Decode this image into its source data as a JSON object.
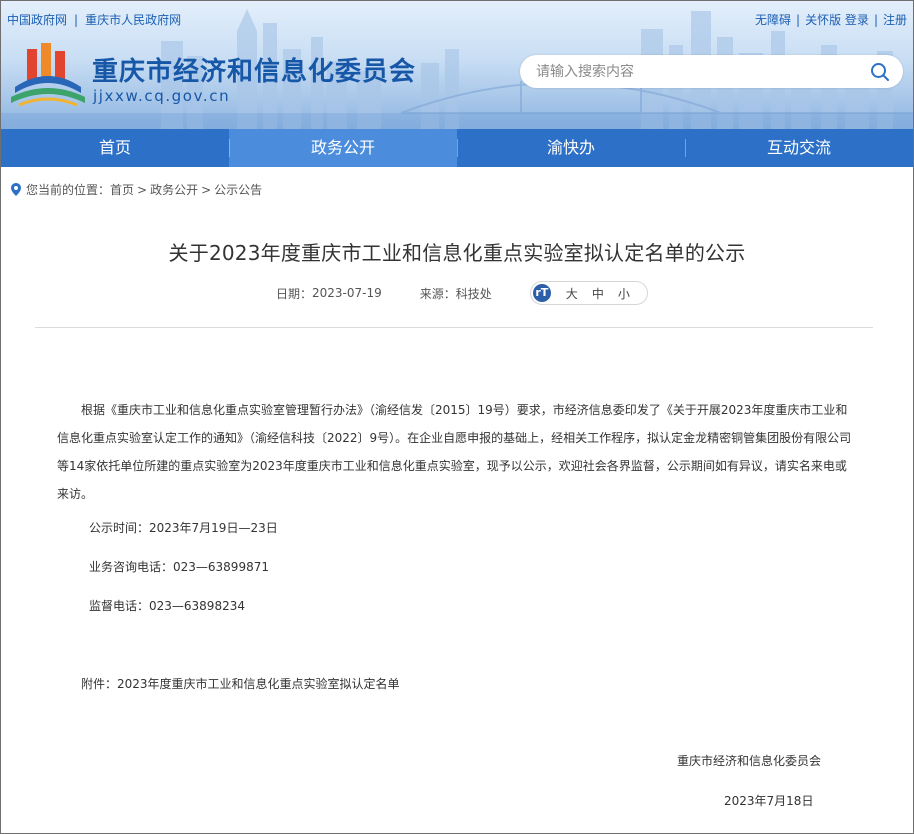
{
  "header": {
    "top_links": [
      "中国政府网",
      "重庆市人民政府网"
    ],
    "right_links": [
      "无障碍",
      "关怀版",
      "登录",
      "注册"
    ],
    "site_title": "重庆市经济和信息化委员会",
    "site_domain": "jjxxw.cq.gov.cn",
    "search_placeholder": "请输入搜索内容",
    "search_icon": "search-icon",
    "logo_icon": "emblem-logo-icon"
  },
  "nav": {
    "items": [
      "首页",
      "政务公开",
      "渝快办",
      "互动交流"
    ],
    "active_index": 1
  },
  "breadcrumb": {
    "prefix": "您当前的位置：",
    "items": [
      "首页",
      "政务公开",
      "公示公告"
    ],
    "separator": ">",
    "icon": "location-pin-icon"
  },
  "article": {
    "title": "关于2023年度重庆市工业和信息化重点实验室拟认定名单的公示",
    "date_label": "日期：",
    "date": "2023-07-19",
    "source_label": "来源：",
    "source": "科技处",
    "font_size_icon": "font-size-icon",
    "font_sizes": [
      "大",
      "中",
      "小"
    ],
    "paragraph": "根据《重庆市工业和信息化重点实验室管理暂行办法》（渝经信发〔2015〕19号）要求，市经济信息委印发了《关于开展2023年度重庆市工业和信息化重点实验室认定工作的通知》（渝经信科技〔2022〕9号）。在企业自愿申报的基础上，经相关工作程序，拟认定金龙精密铜管集团股份有限公司等14家依托单位所建的重点实验室为2023年度重庆市工业和信息化重点实验室，现予以公示，欢迎社会各界监督，公示期间如有异议，请实名来电或来访。",
    "publicity_period": "公示时间：2023年7月19日—23日",
    "consult_phone": "业务咨询电话：023—63899871",
    "supervise_phone": "监督电话：023—63898234",
    "attachment": "附件：2023年度重庆市工业和信息化重点实验室拟认定名单",
    "signature": "重庆市经济和信息化委员会",
    "sign_date": "2023年7月18日"
  },
  "colors": {
    "nav_bg": "#2d70c7",
    "nav_active": "#4b8cdc",
    "title_blue": "#1757a8"
  }
}
